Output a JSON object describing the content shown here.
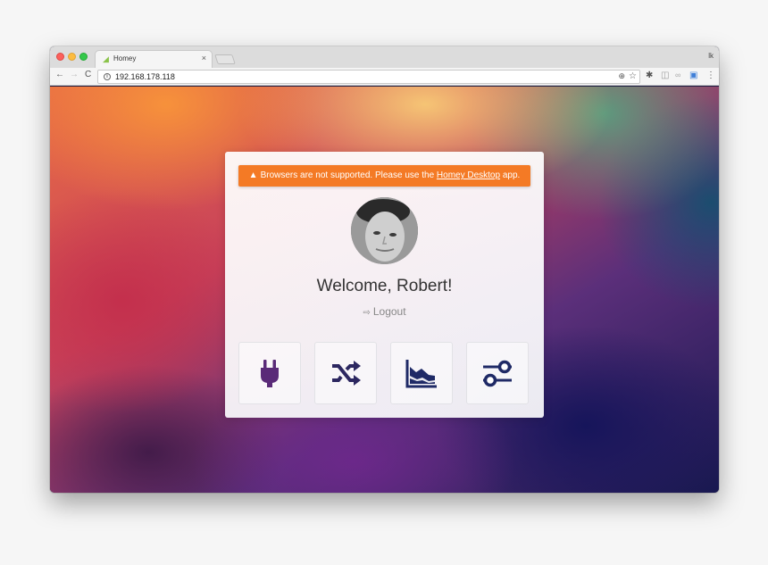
{
  "browser": {
    "tab_title": "Homey",
    "tab_close": "×",
    "profile_initials": "lk",
    "url": "192.168.178.118",
    "nav_back": "←",
    "nav_forward": "→",
    "nav_reload": "C",
    "info": "i",
    "zoom": "⊕",
    "star": "☆",
    "ext_gear": "✱",
    "ext_ghost": "◫",
    "ext_dots": "∞",
    "ext_badge": "▣",
    "menu": "⋮"
  },
  "alert": {
    "icon": "▲",
    "text_before": "Browsers are not supported. Please use the",
    "link": "Homey Desktop",
    "text_after": "app.",
    "color": "#f47a25"
  },
  "welcome": "Welcome, Robert!",
  "logout": {
    "icon": "⇨",
    "label": "Logout"
  },
  "tiles": [
    {
      "name": "Devices",
      "icon": "plug-icon",
      "color": "#5a2a78"
    },
    {
      "name": "Flows",
      "icon": "shuffle-icon",
      "color": "#2c2760"
    },
    {
      "name": "Insights",
      "icon": "area-chart-icon",
      "color": "#1f2a66"
    },
    {
      "name": "Settings",
      "icon": "sliders-icon",
      "color": "#1f2a66"
    }
  ]
}
